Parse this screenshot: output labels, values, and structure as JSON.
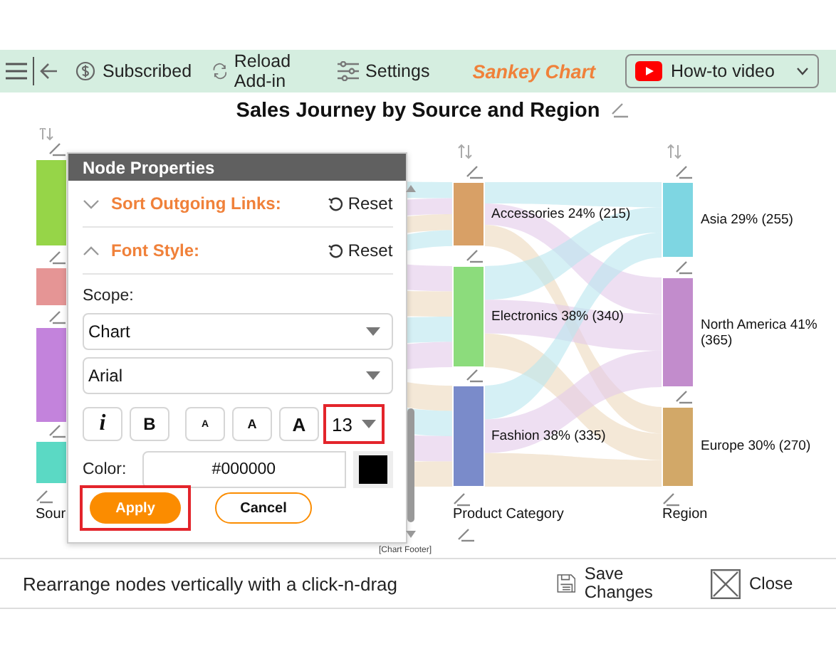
{
  "toolbar": {
    "subscribed": "Subscribed",
    "reload": "Reload Add-in",
    "settings": "Settings",
    "brand": "Sankey Chart",
    "video": "How-to video"
  },
  "chart": {
    "title": "Sales Journey by Source and Region",
    "footer": "[Chart Footer]",
    "columns": [
      {
        "label": "Sour",
        "nodes": [
          {
            "color": "#96d548"
          },
          {
            "color": "#e59595"
          },
          {
            "color": "#c383dc"
          },
          {
            "color": "#5bd9c4"
          }
        ]
      },
      {
        "label": "Product Category",
        "nodes": [
          {
            "label": "Accessories 24% (215)",
            "color": "#d8a066"
          },
          {
            "label": "Electronics 38% (340)",
            "color": "#8cdc7c"
          },
          {
            "label": "Fashion 38% (335)",
            "color": "#7a8bca"
          }
        ]
      },
      {
        "label": "Region",
        "nodes": [
          {
            "label": "Asia 29% (255)",
            "color": "#7ed6e2"
          },
          {
            "label": "North America 41% (365)",
            "color": "#c28ccc"
          },
          {
            "label": "Europe 30% (270)",
            "color": "#d2a868"
          }
        ]
      }
    ]
  },
  "dialog": {
    "title": "Node Properties",
    "sections": [
      {
        "label": "Sort Outgoing Links:",
        "expanded": false,
        "reset": "Reset"
      },
      {
        "label": "Font Style:",
        "expanded": true,
        "reset": "Reset"
      }
    ],
    "scope_label": "Scope:",
    "scope_value": "Chart",
    "font_value": "Arial",
    "style_buttons": [
      {
        "kind": "italic",
        "label": "i"
      },
      {
        "kind": "bold",
        "label": "B"
      },
      {
        "kind": "small",
        "label": "A"
      },
      {
        "kind": "medium",
        "label": "A"
      },
      {
        "kind": "large",
        "label": "A"
      }
    ],
    "size": {
      "value": "13",
      "highlighted": true
    },
    "color_label": "Color:",
    "color_value": "#000000",
    "apply": {
      "label": "Apply",
      "highlighted": true
    },
    "cancel": {
      "label": "Cancel",
      "highlighted": false
    }
  },
  "status": {
    "hint": "Rearrange nodes vertically with a click-n-drag",
    "save": "Save Changes",
    "close": "Close"
  }
}
